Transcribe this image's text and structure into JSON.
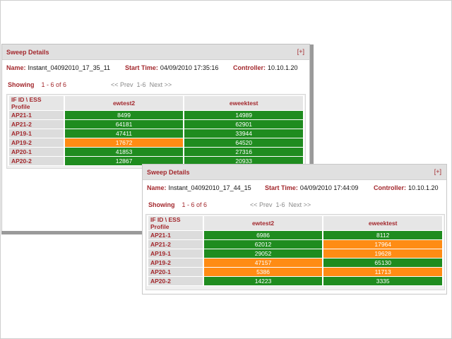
{
  "colors": {
    "accent": "#a3282d",
    "green": "#1f8c1f",
    "orange": "#ff8c14"
  },
  "panels": [
    {
      "title": "Sweep Details",
      "expand": "[+]",
      "name_label": "Name:",
      "name": "Instant_04092010_17_35_11",
      "start_label": "Start Time:",
      "start": "04/09/2010 17:35:16",
      "controller_label": "Controller:",
      "controller": "10.10.1.20",
      "showing_label": "Showing",
      "showing_range": "1 - 6 of 6",
      "pager": {
        "prev": "<< Prev",
        "range": "1-6",
        "next": "Next >>"
      },
      "columns": [
        "IF ID \\ ESS Profile",
        "ewtest2",
        "eweektest"
      ],
      "rows": [
        {
          "id": "AP21-1",
          "cells": [
            {
              "value": "8499",
              "status": "green"
            },
            {
              "value": "14989",
              "status": "green"
            }
          ]
        },
        {
          "id": "AP21-2",
          "cells": [
            {
              "value": "64181",
              "status": "green"
            },
            {
              "value": "62901",
              "status": "green"
            }
          ]
        },
        {
          "id": "AP19-1",
          "cells": [
            {
              "value": "47411",
              "status": "green"
            },
            {
              "value": "33944",
              "status": "green"
            }
          ]
        },
        {
          "id": "AP19-2",
          "cells": [
            {
              "value": "17672",
              "status": "orange"
            },
            {
              "value": "64520",
              "status": "green"
            }
          ]
        },
        {
          "id": "AP20-1",
          "cells": [
            {
              "value": "41853",
              "status": "green"
            },
            {
              "value": "27316",
              "status": "green"
            }
          ]
        },
        {
          "id": "AP20-2",
          "cells": [
            {
              "value": "12867",
              "status": "green"
            },
            {
              "value": "20933",
              "status": "green"
            }
          ]
        }
      ]
    },
    {
      "title": "Sweep Details",
      "expand": "[+]",
      "name_label": "Name:",
      "name": "Instant_04092010_17_44_15",
      "start_label": "Start Time:",
      "start": "04/09/2010 17:44:09",
      "controller_label": "Controller:",
      "controller": "10.10.1.20",
      "showing_label": "Showing",
      "showing_range": "1 - 6 of 6",
      "pager": {
        "prev": "<< Prev",
        "range": "1-6",
        "next": "Next >>"
      },
      "columns": [
        "IF ID \\ ESS Profile",
        "ewtest2",
        "eweektest"
      ],
      "rows": [
        {
          "id": "AP21-1",
          "cells": [
            {
              "value": "6986",
              "status": "green"
            },
            {
              "value": "8112",
              "status": "green"
            }
          ]
        },
        {
          "id": "AP21-2",
          "cells": [
            {
              "value": "62012",
              "status": "green"
            },
            {
              "value": "17964",
              "status": "orange"
            }
          ]
        },
        {
          "id": "AP19-1",
          "cells": [
            {
              "value": "29052",
              "status": "green"
            },
            {
              "value": "19628",
              "status": "orange"
            }
          ]
        },
        {
          "id": "AP19-2",
          "cells": [
            {
              "value": "47157",
              "status": "orange"
            },
            {
              "value": "65130",
              "status": "green"
            }
          ]
        },
        {
          "id": "AP20-1",
          "cells": [
            {
              "value": "5386",
              "status": "orange"
            },
            {
              "value": "11713",
              "status": "orange"
            }
          ]
        },
        {
          "id": "AP20-2",
          "cells": [
            {
              "value": "14223",
              "status": "green"
            },
            {
              "value": "3335",
              "status": "green"
            }
          ]
        }
      ]
    }
  ]
}
